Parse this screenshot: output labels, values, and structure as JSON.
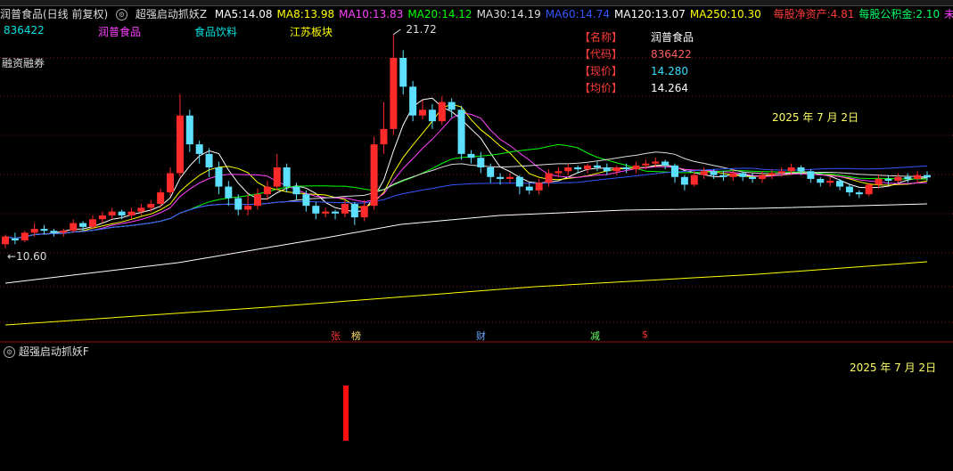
{
  "header": {
    "stock_name": "润普食品(日线 前复权)",
    "indicator": "超强启动抓妖Z",
    "ma": [
      {
        "label": "MA5:",
        "value": "14.08",
        "color": "#ffffff"
      },
      {
        "label": "MA8:",
        "value": "13.98",
        "color": "#ffff00"
      },
      {
        "label": "MA10:",
        "value": "13.83",
        "color": "#ff40ff"
      },
      {
        "label": "MA20:",
        "value": "14.12",
        "color": "#00ff00"
      },
      {
        "label": "MA30:",
        "value": "14.19",
        "color": "#dddddd"
      },
      {
        "label": "MA60:",
        "value": "14.74",
        "color": "#3355ff"
      },
      {
        "label": "MA120:",
        "value": "13.07",
        "color": "#ffffff"
      },
      {
        "label": "MA250:",
        "value": "10.30",
        "color": "#ffff00"
      }
    ],
    "fin": [
      {
        "label": "每股净资产:",
        "value": "4.81",
        "color": "#ff3b3b"
      },
      {
        "label": "每股公积金:",
        "value": "2.10",
        "color": "#00ff66"
      },
      {
        "label": "未分配利",
        "value": "",
        "color": "#ff40ff"
      }
    ]
  },
  "tags": {
    "code": "836422",
    "name": "润普食品",
    "industry": "食品饮料",
    "region": "江苏板块",
    "margin": "融资融券"
  },
  "info_box": {
    "rows": [
      {
        "label": "【名称】",
        "value": "润普食品",
        "color": "#ffffff"
      },
      {
        "label": "【代码】",
        "value": "836422",
        "color": "#ff6060"
      },
      {
        "label": "【现价】",
        "value": "14.280",
        "color": "#33ddff"
      },
      {
        "label": "【均价】",
        "value": "14.264",
        "color": "#ffffff"
      }
    ]
  },
  "dates": {
    "main": "2025 年 7 月 2日",
    "sub": "2025 年 7 月 2日"
  },
  "sub_panel": {
    "title": "超强启动抓妖F"
  },
  "events": [
    {
      "text": "张",
      "color": "#ff3333"
    },
    {
      "text": "榜",
      "color": "#ffdd66"
    },
    {
      "text": "财",
      "color": "#66aaff"
    },
    {
      "text": "减",
      "color": "#66ff66"
    },
    {
      "text": "$",
      "color": "#ff3333"
    }
  ],
  "chart_data": {
    "type": "candlestick",
    "high_label": "21.72",
    "low_label": "10.60",
    "candles": [
      [
        10.8,
        11.2,
        10.6,
        11.3
      ],
      [
        11.1,
        11.0,
        10.8,
        11.4
      ],
      [
        11.0,
        11.4,
        10.9,
        11.5
      ],
      [
        11.4,
        11.6,
        11.2,
        11.9
      ],
      [
        11.6,
        11.5,
        11.3,
        11.8
      ],
      [
        11.5,
        11.4,
        11.2,
        11.6
      ],
      [
        11.4,
        11.5,
        11.2,
        11.6
      ],
      [
        11.5,
        11.9,
        11.4,
        12.1
      ],
      [
        11.9,
        11.7,
        11.5,
        12.0
      ],
      [
        11.7,
        12.1,
        11.6,
        12.3
      ],
      [
        12.1,
        12.3,
        11.9,
        12.5
      ],
      [
        12.3,
        12.5,
        12.1,
        12.7
      ],
      [
        12.5,
        12.3,
        12.1,
        12.6
      ],
      [
        12.3,
        12.5,
        12.1,
        12.7
      ],
      [
        12.5,
        12.7,
        12.3,
        12.9
      ],
      [
        12.7,
        12.9,
        12.5,
        13.1
      ],
      [
        12.9,
        13.5,
        12.7,
        13.7
      ],
      [
        13.5,
        14.5,
        13.3,
        14.8
      ],
      [
        14.5,
        17.5,
        14.3,
        18.6
      ],
      [
        17.5,
        16.0,
        15.6,
        17.8
      ],
      [
        16.0,
        15.5,
        15.0,
        16.2
      ],
      [
        15.5,
        14.8,
        14.3,
        15.8
      ],
      [
        14.8,
        13.8,
        13.4,
        15.1
      ],
      [
        13.8,
        13.2,
        12.8,
        14.1
      ],
      [
        13.2,
        12.6,
        12.3,
        13.4
      ],
      [
        12.6,
        12.8,
        12.3,
        13.4
      ],
      [
        12.8,
        13.4,
        12.6,
        13.7
      ],
      [
        13.4,
        13.8,
        13.1,
        14.1
      ],
      [
        13.8,
        14.8,
        13.6,
        15.5
      ],
      [
        14.8,
        13.8,
        13.5,
        15.0
      ],
      [
        13.8,
        13.4,
        13.1,
        14.0
      ],
      [
        13.4,
        12.8,
        12.5,
        13.6
      ],
      [
        12.8,
        12.4,
        12.1,
        13.0
      ],
      [
        12.4,
        12.5,
        12.2,
        12.7
      ],
      [
        12.5,
        12.4,
        12.1,
        12.6
      ],
      [
        12.4,
        12.9,
        12.2,
        13.1
      ],
      [
        12.9,
        12.2,
        11.8,
        13.0
      ],
      [
        12.2,
        12.8,
        12.0,
        13.1
      ],
      [
        12.8,
        16.0,
        12.6,
        16.4
      ],
      [
        16.0,
        16.8,
        15.5,
        18.2
      ],
      [
        16.8,
        20.5,
        16.5,
        21.72
      ],
      [
        20.5,
        19.0,
        18.6,
        20.9
      ],
      [
        19.0,
        17.5,
        17.2,
        19.3
      ],
      [
        17.5,
        17.8,
        17.3,
        18.3
      ],
      [
        17.8,
        17.2,
        16.8,
        18.1
      ],
      [
        17.2,
        18.2,
        17.0,
        18.5
      ],
      [
        18.2,
        17.8,
        17.4,
        18.4
      ],
      [
        17.8,
        15.5,
        15.2,
        18.0
      ],
      [
        15.5,
        15.3,
        15.0,
        15.7
      ],
      [
        15.3,
        14.8,
        14.5,
        15.6
      ],
      [
        14.8,
        14.3,
        14.0,
        15.0
      ],
      [
        14.3,
        14.2,
        13.9,
        14.5
      ],
      [
        14.2,
        14.3,
        14.0,
        14.5
      ],
      [
        14.3,
        13.8,
        13.4,
        14.4
      ],
      [
        13.8,
        13.6,
        13.4,
        14.0
      ],
      [
        13.6,
        14.0,
        13.4,
        14.2
      ],
      [
        14.0,
        14.5,
        13.8,
        14.7
      ],
      [
        14.5,
        14.6,
        14.3,
        14.8
      ],
      [
        14.6,
        14.8,
        14.4,
        15.0
      ],
      [
        14.8,
        14.7,
        14.5,
        14.9
      ],
      [
        14.7,
        14.9,
        14.5,
        15.0
      ],
      [
        14.9,
        14.8,
        14.6,
        15.1
      ],
      [
        14.8,
        14.6,
        14.4,
        15.0
      ],
      [
        14.6,
        14.8,
        14.4,
        14.9
      ],
      [
        14.8,
        14.7,
        14.5,
        15.0
      ],
      [
        14.7,
        14.9,
        14.5,
        15.1
      ],
      [
        14.9,
        15.0,
        14.7,
        15.2
      ],
      [
        15.0,
        15.1,
        14.8,
        15.3
      ],
      [
        15.1,
        14.9,
        14.7,
        15.2
      ],
      [
        14.9,
        14.3,
        14.0,
        15.0
      ],
      [
        14.3,
        13.9,
        13.6,
        14.4
      ],
      [
        13.9,
        14.4,
        13.8,
        14.6
      ],
      [
        14.4,
        14.6,
        14.2,
        14.8
      ],
      [
        14.6,
        14.4,
        14.2,
        14.7
      ],
      [
        14.4,
        14.3,
        14.1,
        14.6
      ],
      [
        14.3,
        14.5,
        14.1,
        14.7
      ],
      [
        14.5,
        14.3,
        14.1,
        14.6
      ],
      [
        14.3,
        14.2,
        14.0,
        14.5
      ],
      [
        14.2,
        14.4,
        14.0,
        14.6
      ],
      [
        14.4,
        14.5,
        14.2,
        14.7
      ],
      [
        14.5,
        14.6,
        14.3,
        14.8
      ],
      [
        14.6,
        14.8,
        14.4,
        15.0
      ],
      [
        14.8,
        14.6,
        14.4,
        14.9
      ],
      [
        14.6,
        14.2,
        14.0,
        14.7
      ],
      [
        14.2,
        14.0,
        13.8,
        14.3
      ],
      [
        14.0,
        14.1,
        13.8,
        14.3
      ],
      [
        14.1,
        13.8,
        13.6,
        14.2
      ],
      [
        13.8,
        13.5,
        13.3,
        13.9
      ],
      [
        13.5,
        13.4,
        13.2,
        13.6
      ],
      [
        13.4,
        13.9,
        13.3,
        14.0
      ],
      [
        13.9,
        14.2,
        13.7,
        14.4
      ],
      [
        14.2,
        14.1,
        13.9,
        14.4
      ],
      [
        14.1,
        14.3,
        14.0,
        14.5
      ],
      [
        14.3,
        14.2,
        14.0,
        14.5
      ],
      [
        14.2,
        14.4,
        14.0,
        14.6
      ],
      [
        14.4,
        14.28,
        14.1,
        14.6
      ]
    ]
  }
}
